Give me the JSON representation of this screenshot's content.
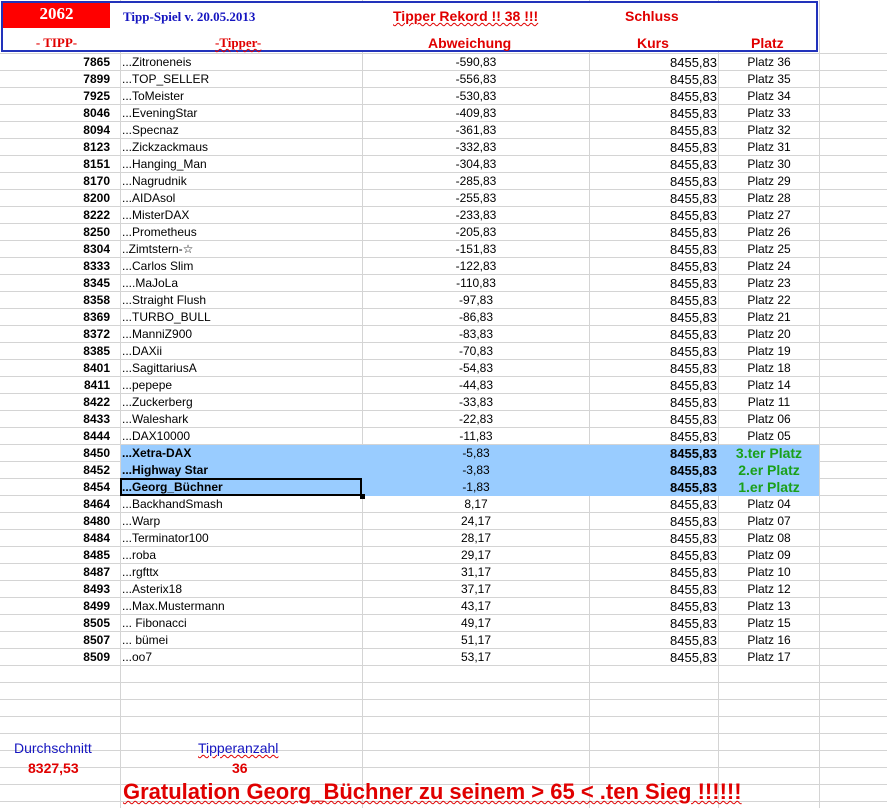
{
  "header": {
    "tipp_number": "2062",
    "title": "Tipp-Spiel v. 20.05.2013",
    "rekord": "Tipper Rekord !!  38  !!!",
    "schluss": "Schluss",
    "col_tipp": "- TIPP-",
    "col_tipper": "-Tipper-",
    "col_abweichung": "Abweichung",
    "col_kurs": "Kurs",
    "col_platz": "Platz"
  },
  "rows": [
    {
      "tipp": "7865",
      "tipper": "...Zitroneneis",
      "abw": "-590,83",
      "kurs": "8455,83",
      "platz": "Platz 36"
    },
    {
      "tipp": "7899",
      "tipper": "...TOP_SELLER",
      "abw": "-556,83",
      "kurs": "8455,83",
      "platz": "Platz 35"
    },
    {
      "tipp": "7925",
      "tipper": "...ToMeister",
      "abw": "-530,83",
      "kurs": "8455,83",
      "platz": "Platz 34"
    },
    {
      "tipp": "8046",
      "tipper": "...EveningStar",
      "abw": "-409,83",
      "kurs": "8455,83",
      "platz": "Platz 33"
    },
    {
      "tipp": "8094",
      "tipper": "...Specnaz",
      "abw": "-361,83",
      "kurs": "8455,83",
      "platz": "Platz 32"
    },
    {
      "tipp": "8123",
      "tipper": "...Zickzackmaus",
      "abw": "-332,83",
      "kurs": "8455,83",
      "platz": "Platz 31"
    },
    {
      "tipp": "8151",
      "tipper": "...Hanging_Man",
      "abw": "-304,83",
      "kurs": "8455,83",
      "platz": "Platz 30"
    },
    {
      "tipp": "8170",
      "tipper": "...Nagrudnik",
      "abw": "-285,83",
      "kurs": "8455,83",
      "platz": "Platz 29"
    },
    {
      "tipp": "8200",
      "tipper": "...AIDAsol",
      "abw": "-255,83",
      "kurs": "8455,83",
      "platz": "Platz 28"
    },
    {
      "tipp": "8222",
      "tipper": "...MisterDAX",
      "abw": "-233,83",
      "kurs": "8455,83",
      "platz": "Platz 27"
    },
    {
      "tipp": "8250",
      "tipper": "...Prometheus",
      "abw": "-205,83",
      "kurs": "8455,83",
      "platz": "Platz 26"
    },
    {
      "tipp": "8304",
      "tipper": "..Zimtstern-☆",
      "abw": "-151,83",
      "kurs": "8455,83",
      "platz": "Platz 25"
    },
    {
      "tipp": "8333",
      "tipper": "...Carlos Slim",
      "abw": "-122,83",
      "kurs": "8455,83",
      "platz": "Platz 24"
    },
    {
      "tipp": "8345",
      "tipper": "....MaJoLa",
      "abw": "-110,83",
      "kurs": "8455,83",
      "platz": "Platz 23"
    },
    {
      "tipp": "8358",
      "tipper": "...Straight Flush",
      "abw": "-97,83",
      "kurs": "8455,83",
      "platz": "Platz 22"
    },
    {
      "tipp": "8369",
      "tipper": "...TURBO_BULL",
      "abw": "-86,83",
      "kurs": "8455,83",
      "platz": "Platz 21"
    },
    {
      "tipp": "8372",
      "tipper": "...ManniZ900",
      "abw": "-83,83",
      "kurs": "8455,83",
      "platz": "Platz 20"
    },
    {
      "tipp": "8385",
      "tipper": "...DAXii",
      "abw": "-70,83",
      "kurs": "8455,83",
      "platz": "Platz 19"
    },
    {
      "tipp": "8401",
      "tipper": "...SagittariusA",
      "abw": "-54,83",
      "kurs": "8455,83",
      "platz": "Platz 18"
    },
    {
      "tipp": "8411",
      "tipper": "...pepepe",
      "abw": "-44,83",
      "kurs": "8455,83",
      "platz": "Platz 14"
    },
    {
      "tipp": "8422",
      "tipper": "...Zuckerberg",
      "abw": "-33,83",
      "kurs": "8455,83",
      "platz": "Platz 11"
    },
    {
      "tipp": "8433",
      "tipper": "...Waleshark",
      "abw": "-22,83",
      "kurs": "8455,83",
      "platz": "Platz 06"
    },
    {
      "tipp": "8444",
      "tipper": "...DAX10000",
      "abw": "-11,83",
      "kurs": "8455,83",
      "platz": "Platz 05"
    },
    {
      "tipp": "8450",
      "tipper": "...Xetra-DAX",
      "abw": "-5,83",
      "kurs": "8455,83",
      "platz": "3.ter Platz"
    },
    {
      "tipp": "8452",
      "tipper": "...Highway Star",
      "abw": "-3,83",
      "kurs": "8455,83",
      "platz": "2.er Platz"
    },
    {
      "tipp": "8454",
      "tipper": "...Georg_Büchner",
      "abw": "-1,83",
      "kurs": "8455,83",
      "platz": "1.er Platz"
    },
    {
      "tipp": "8464",
      "tipper": "...BackhandSmash",
      "abw": "8,17",
      "kurs": "8455,83",
      "platz": "Platz 04"
    },
    {
      "tipp": "8480",
      "tipper": "...Warp",
      "abw": "24,17",
      "kurs": "8455,83",
      "platz": "Platz 07"
    },
    {
      "tipp": "8484",
      "tipper": "...Terminator100",
      "abw": "28,17",
      "kurs": "8455,83",
      "platz": "Platz 08"
    },
    {
      "tipp": "8485",
      "tipper": "...roba",
      "abw": "29,17",
      "kurs": "8455,83",
      "platz": "Platz 09"
    },
    {
      "tipp": "8487",
      "tipper": "...rgfttx",
      "abw": "31,17",
      "kurs": "8455,83",
      "platz": "Platz 10"
    },
    {
      "tipp": "8493",
      "tipper": "...Asterix18",
      "abw": "37,17",
      "kurs": "8455,83",
      "platz": "Platz 12"
    },
    {
      "tipp": "8499",
      "tipper": "...Max.Mustermann",
      "abw": "43,17",
      "kurs": "8455,83",
      "platz": "Platz 13"
    },
    {
      "tipp": "8505",
      "tipper": "... Fibonacci",
      "abw": "49,17",
      "kurs": "8455,83",
      "platz": "Platz 15"
    },
    {
      "tipp": "8507",
      "tipper": "... bümei",
      "abw": "51,17",
      "kurs": "8455,83",
      "platz": "Platz 16"
    },
    {
      "tipp": "8509",
      "tipper": "...oo7",
      "abw": "53,17",
      "kurs": "8455,83",
      "platz": "Platz 17"
    }
  ],
  "footer": {
    "durchschnitt_label": "Durchschnitt",
    "durchschnitt_value": "8327,53",
    "tipperanzahl_label": "Tipperanzahl",
    "tipperanzahl_value": "36",
    "gratulation": "Gratulation Georg_Büchner  zu seinem > 65 < .ten Sieg !!!!!!"
  },
  "colors": {
    "highlight": "#99ccff",
    "header_border": "#2233bb",
    "red": "#e00000",
    "blue": "#1515c0",
    "winner_green": "#1aa01a"
  }
}
